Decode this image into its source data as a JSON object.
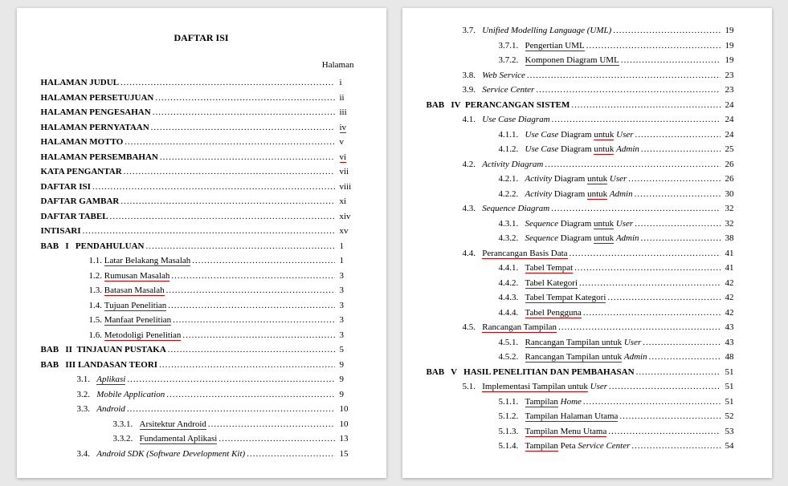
{
  "title": "DAFTAR ISI",
  "halaman_label": "Halaman",
  "page1": [
    {
      "type": "front",
      "label": "HALAMAN JUDUL",
      "page": "i",
      "bold": true
    },
    {
      "type": "front",
      "label": "HALAMAN PERSETUJUAN",
      "page": "ii",
      "bold": true
    },
    {
      "type": "front",
      "label": "HALAMAN PENGESAHAN",
      "page": "iii",
      "bold": true
    },
    {
      "type": "front",
      "label": "HALAMAN PERNYATAAN",
      "page": "iv",
      "bold": true,
      "red": "iv"
    },
    {
      "type": "front",
      "label": "HALAMAN MOTTO",
      "page": "v",
      "bold": true
    },
    {
      "type": "front",
      "label": "HALAMAN PERSEMBAHAN",
      "page": "vi",
      "bold": true,
      "red": "vi"
    },
    {
      "type": "front",
      "label": "KATA PENGANTAR",
      "page": "vii",
      "bold": true
    },
    {
      "type": "front",
      "label": "DAFTAR ISI",
      "page": "viii",
      "bold": true
    },
    {
      "type": "front",
      "label": "DAFTAR GAMBAR",
      "page": "xi",
      "bold": true
    },
    {
      "type": "front",
      "label": "DAFTAR TABEL",
      "page": "xiv",
      "bold": true
    },
    {
      "type": "front",
      "label": "INTISARI",
      "page": "xv",
      "bold": true
    },
    {
      "type": "bab",
      "prefix": "BAB   I   ",
      "label": "PENDAHULUAN",
      "page": "1",
      "bold": true
    },
    {
      "type": "sub1",
      "prefix": "1.1. ",
      "label": "Latar Belakang Masalah",
      "page": "1",
      "red": true
    },
    {
      "type": "sub1",
      "prefix": "1.2. ",
      "label": "Rumusan Masalah",
      "page": "3",
      "red": true
    },
    {
      "type": "sub1",
      "prefix": "1.3. ",
      "label": "Batasan Masalah",
      "page": "3",
      "red": true
    },
    {
      "type": "sub1",
      "prefix": "1.4. ",
      "label": "Tujuan Penelitian",
      "page": "3",
      "red": true
    },
    {
      "type": "sub1",
      "prefix": "1.5. ",
      "label": "Manfaat Penelitian",
      "page": "3",
      "red": true
    },
    {
      "type": "sub1",
      "prefix": "1.6. ",
      "label": "Metodoligi Penelitian",
      "page": "3",
      "red": true
    },
    {
      "type": "bab",
      "prefix": "BAB   II  ",
      "label": "TINJAUAN PUSTAKA",
      "page": "5",
      "bold": true
    },
    {
      "type": "bab",
      "prefix": "BAB   III ",
      "label": "LANDASAN TEORI",
      "page": "9",
      "bold": true
    },
    {
      "type": "sec",
      "prefix": "3.1.   ",
      "label": "Aplikasi",
      "page": "9",
      "italic": true,
      "red": true
    },
    {
      "type": "sec",
      "prefix": "3.2.   ",
      "label": "Mobile Application",
      "page": "9",
      "italic": true
    },
    {
      "type": "sec",
      "prefix": "3.3.   ",
      "label": "Android",
      "page": "10",
      "italic": true
    },
    {
      "type": "sub2",
      "prefix": "3.3.1.   ",
      "label": "Arsitektur Android",
      "page": "10",
      "red": true
    },
    {
      "type": "sub2",
      "prefix": "3.3.2.   ",
      "label": "Fundamental Aplikasi",
      "page": "13",
      "red": true
    },
    {
      "type": "sec",
      "prefix": "3.4.   ",
      "label": "Android SDK (Software Development Kit)",
      "page": "15",
      "italic": true
    }
  ],
  "page2": [
    {
      "type": "sec",
      "prefix": "3.7.   ",
      "label": "Unified Modelling Language (UML)",
      "page": "19",
      "italic": true
    },
    {
      "type": "sub2",
      "prefix": "3.7.1.   ",
      "label": "Pengertian UML",
      "page": "19",
      "red": true
    },
    {
      "type": "sub2",
      "prefix": "3.7.2.   ",
      "label": "Komponen Diagram UML",
      "page": "19",
      "red": true
    },
    {
      "type": "sec",
      "prefix": "3.8.   ",
      "label": "Web Service",
      "page": "23",
      "italic": true
    },
    {
      "type": "sec",
      "prefix": "3.9.   ",
      "label": "Service Center",
      "page": "23",
      "italic": true
    },
    {
      "type": "bab",
      "prefix": "BAB   IV  ",
      "label": "PERANCANGAN SISTEM",
      "page": "24",
      "bold": true
    },
    {
      "type": "sec",
      "prefix": "4.1.   ",
      "label": "Use Case Diagram",
      "page": "24",
      "italic": true
    },
    {
      "type": "sub2",
      "prefix": "4.1.1.   ",
      "label_html": "<span class='italic'>Use Case</span> Diagram <span class='red-underline'>untuk</span> <span class='italic'>User</span>",
      "page": "24"
    },
    {
      "type": "sub2",
      "prefix": "4.1.2.   ",
      "label_html": "<span class='italic'>Use Case</span> Diagram <span class='red-underline'>untuk</span> <span class='italic'>Admin</span>",
      "page": "25"
    },
    {
      "type": "sec",
      "prefix": "4.2.   ",
      "label": "Activity Diagram",
      "page": "26",
      "italic": true
    },
    {
      "type": "sub2",
      "prefix": "4.2.1.   ",
      "label_html": "<span class='italic'>Activity</span> Diagram <span class='red-underline'>untuk</span> <span class='italic'>User</span>",
      "page": "26"
    },
    {
      "type": "sub2",
      "prefix": "4.2.2.   ",
      "label_html": "<span class='italic'>Activity</span> Diagram <span class='red-underline'>untuk</span> <span class='italic'>Admin</span>",
      "page": "30"
    },
    {
      "type": "sec",
      "prefix": "4.3.   ",
      "label": "Sequence Diagram",
      "page": "32",
      "italic": true
    },
    {
      "type": "sub2",
      "prefix": "4.3.1.   ",
      "label_html": "<span class='italic'>Sequence</span> Diagram <span class='red-underline'>untuk</span> <span class='italic'>User</span>",
      "page": "32"
    },
    {
      "type": "sub2",
      "prefix": "4.3.2.   ",
      "label_html": "<span class='italic'>Sequence</span> Diagram <span class='red-underline'>untuk</span> <span class='italic'>Admin</span>",
      "page": "38"
    },
    {
      "type": "sec",
      "prefix": "4.4.   ",
      "label": "Perancangan Basis Data",
      "page": "41",
      "red": true
    },
    {
      "type": "sub2",
      "prefix": "4.4.1.   ",
      "label": "Tabel Tempat",
      "page": "41",
      "red": true
    },
    {
      "type": "sub2",
      "prefix": "4.4.2.   ",
      "label": "Tabel Kategori",
      "page": "42",
      "red": true
    },
    {
      "type": "sub2",
      "prefix": "4.4.3.   ",
      "label": "Tabel Tempat Kategori",
      "page": "42",
      "red": true
    },
    {
      "type": "sub2",
      "prefix": "4.4.4.   ",
      "label": "Tabel Pengguna",
      "page": "42",
      "red": true
    },
    {
      "type": "sec",
      "prefix": "4.5.   ",
      "label": "Rancangan Tampilan",
      "page": "43",
      "red": true
    },
    {
      "type": "sub2",
      "prefix": "4.5.1.   ",
      "label_html": "<span class='red-underline'>Rancangan Tampilan untuk</span> <span class='italic'>User</span>",
      "page": "43"
    },
    {
      "type": "sub2",
      "prefix": "4.5.2.   ",
      "label_html": "<span class='red-underline'>Rancangan Tampilan untuk</span> <span class='italic'>Admin</span>",
      "page": "48"
    },
    {
      "type": "bab",
      "prefix": "BAB   V   ",
      "label": "HASIL PENELITIAN DAN PEMBAHASAN",
      "page": "51",
      "bold": true
    },
    {
      "type": "sec",
      "prefix": "5.1.   ",
      "label_html": "<span class='red-underline'>Implementasi Tampilan untuk</span> <span class='italic'>User</span>",
      "page": "51"
    },
    {
      "type": "sub2",
      "prefix": "5.1.1.   ",
      "label_html": "<span class='red-underline'>Tampilan</span> <span class='italic'>Home</span>",
      "page": "51"
    },
    {
      "type": "sub2",
      "prefix": "5.1.2.   ",
      "label": "Tampilan Halaman Utama",
      "page": "52",
      "red": true
    },
    {
      "type": "sub2",
      "prefix": "5.1.3.   ",
      "label": "Tampilan Menu Utama",
      "page": "53",
      "red": true
    },
    {
      "type": "sub2",
      "prefix": "5.1.4.   ",
      "label_html": "<span class='red-underline'>Tampilan</span> Peta <span class='italic'>Service Center</span>",
      "page": "54"
    }
  ]
}
